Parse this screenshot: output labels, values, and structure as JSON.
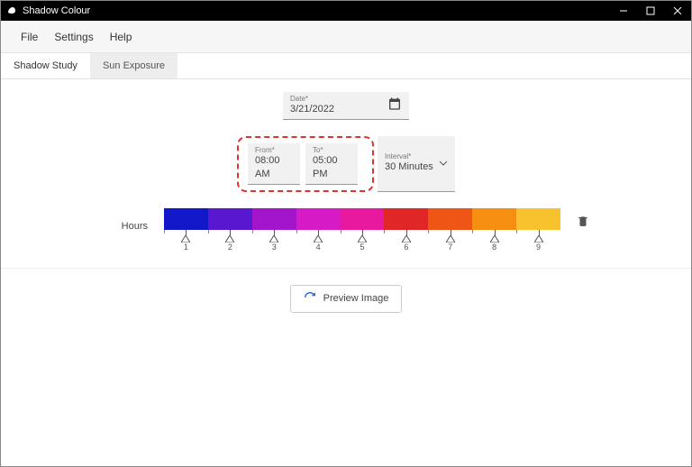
{
  "window": {
    "title": "Shadow Colour"
  },
  "menubar": {
    "file": "File",
    "settings": "Settings",
    "help": "Help"
  },
  "tabs": {
    "shadow_study": "Shadow Study",
    "sun_exposure": "Sun Exposure"
  },
  "date_field": {
    "label": "Date*",
    "value": "3/21/2022"
  },
  "from_field": {
    "label": "From*",
    "value": "08:00 AM"
  },
  "to_field": {
    "label": "To*",
    "value": "05:00 PM"
  },
  "interval_field": {
    "label": "Interval*",
    "value": "30 Minutes"
  },
  "hours_label": "Hours",
  "preview_button": "Preview Image",
  "chart_data": {
    "type": "bar",
    "title": "",
    "xlabel": "Hours",
    "ylabel": "",
    "categories": [
      "1",
      "2",
      "3",
      "4",
      "5",
      "6",
      "7",
      "8",
      "9"
    ],
    "values": [
      1,
      2,
      3,
      4,
      5,
      6,
      7,
      8,
      9
    ],
    "colors": [
      "#1217ca",
      "#5a17d0",
      "#a215cb",
      "#d61bc6",
      "#e8199e",
      "#e02626",
      "#ef5514",
      "#f68e12",
      "#f8c22e"
    ]
  }
}
